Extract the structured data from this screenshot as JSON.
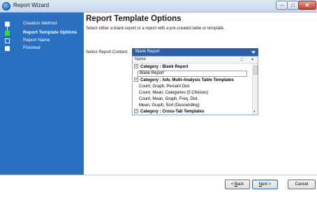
{
  "window": {
    "title": "Report Wizard"
  },
  "steps": [
    {
      "label": "Creation Method",
      "state": "done"
    },
    {
      "label": "Report Template Options",
      "state": "active"
    },
    {
      "label": "Report Name",
      "state": "pending"
    },
    {
      "label": "Finished",
      "state": "pending"
    }
  ],
  "header": {
    "title": "Report Template Options",
    "subtitle": "Select either a blank report or a report with a pre-created table or template."
  },
  "form": {
    "content_label": "Select Report Content:",
    "selected_value": "Blank Report"
  },
  "dropdown": {
    "column_name": "Name",
    "rows": [
      {
        "text": "Category : Blank Report",
        "kind": "category"
      },
      {
        "text": "Blank Report",
        "kind": "item",
        "selected": true
      },
      {
        "text": "Category : Adv. Multi-Analysis Table Templates",
        "kind": "category"
      },
      {
        "text": "Count, Graph, Percent Dist.",
        "kind": "item"
      },
      {
        "text": "Count, Mean, Categories (5 Choices)",
        "kind": "item"
      },
      {
        "text": "Count, Mean, Graph, Freq. Dist.",
        "kind": "item"
      },
      {
        "text": "Mean, Graph, Sort (Descending)",
        "kind": "item"
      },
      {
        "text": "Category : Cross-Tab Templates",
        "kind": "category"
      }
    ]
  },
  "buttons": {
    "back_prefix": "< ",
    "back_key": "B",
    "back_rest": "ack",
    "next_key": "N",
    "next_rest": "ext >",
    "cancel": "Cancel"
  },
  "colors": {
    "sidebar": "#2a6fc0",
    "active_step": "#2ee02e",
    "select_highlight": "#2b5ea8"
  },
  "icons": {
    "app": "wizard-app-icon",
    "minimize": "minimize-icon",
    "maximize": "maximize-icon",
    "close": "close-icon"
  }
}
